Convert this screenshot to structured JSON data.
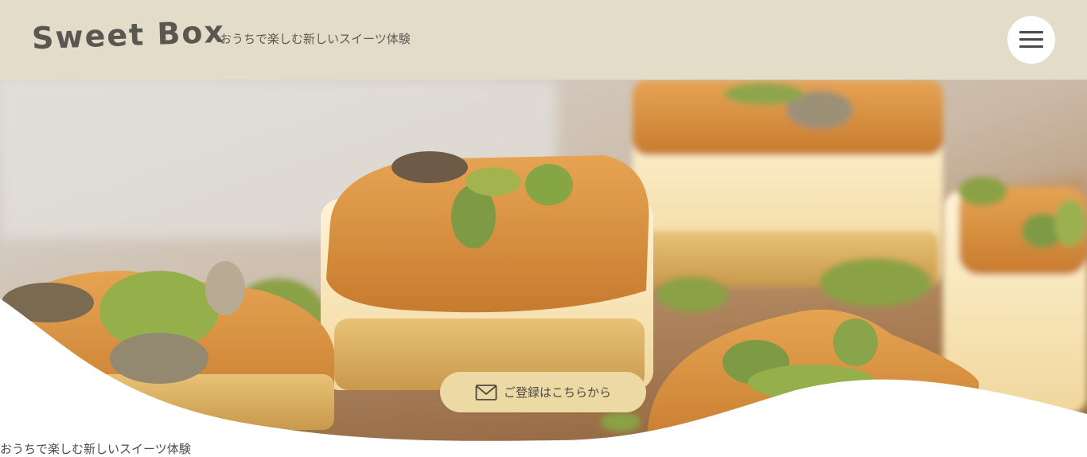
{
  "header": {
    "logo": "Sweet Box",
    "tagline": "おうちで楽しむ新しいスイーツ体験",
    "menu_icon": "hamburger-menu-icon"
  },
  "hero": {
    "image": "cheesecake-bars-with-pistachio",
    "cta_label": "ご登録はこちらから",
    "cta_icon": "envelope-icon"
  },
  "main": {
    "intro_text": "おうちで楽しむ新しいスイーツ体験"
  },
  "colors": {
    "header_bg": "#e3dcc8",
    "button_bg": "#ecd9a4",
    "text": "#5a5652"
  }
}
